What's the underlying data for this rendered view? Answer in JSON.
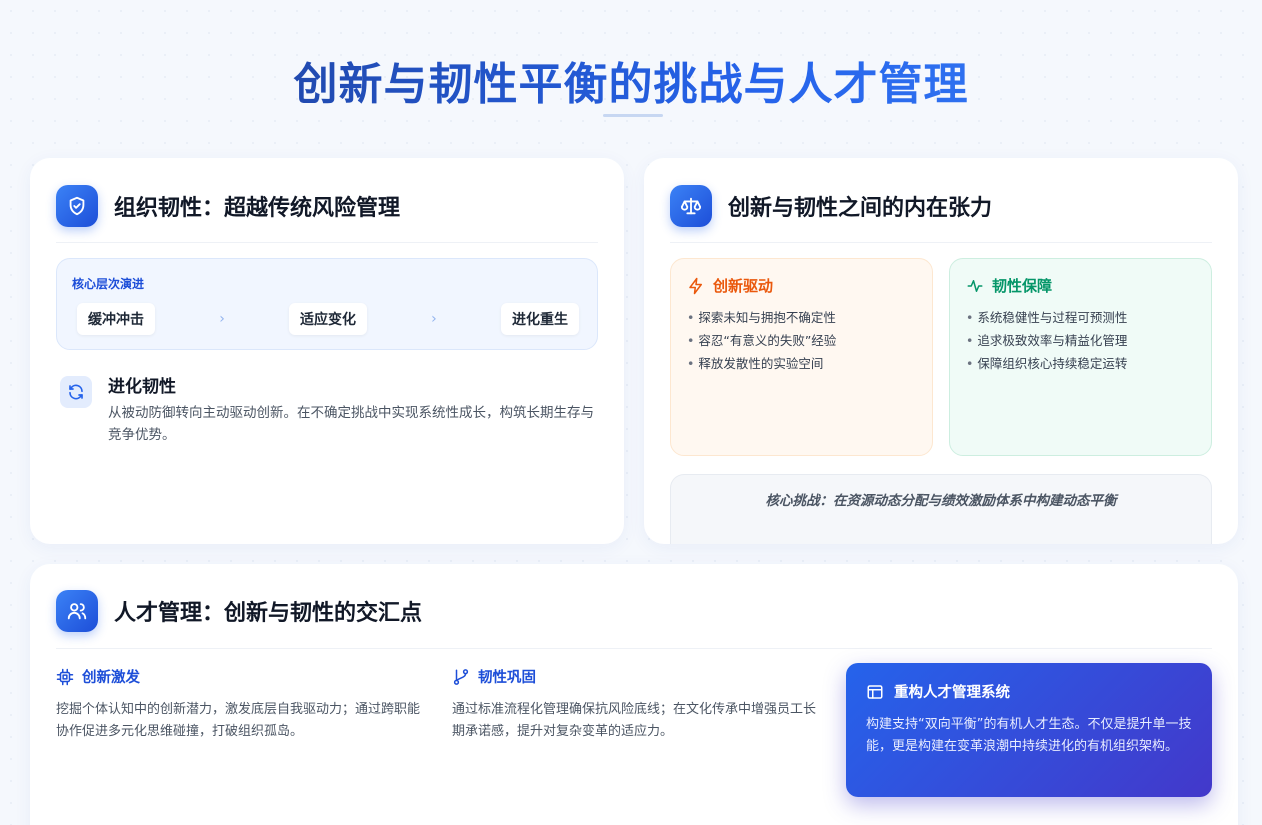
{
  "page": {
    "title": "创新与韧性平衡的挑战与人才管理"
  },
  "resilience_card": {
    "title": "组织韧性：超越传统风险管理",
    "icon": "shield-check-icon",
    "evolution": {
      "label": "核心层次演进",
      "steps": [
        "缓冲冲击",
        "适应变化",
        "进化重生"
      ]
    },
    "feature": {
      "icon": "refresh-icon",
      "title": "进化韧性",
      "desc": "从被动防御转向主动驱动创新。在不确定挑战中实现系统性成长，构筑长期生存与竞争优势。"
    }
  },
  "tension_card": {
    "title": "创新与韧性之间的内在张力",
    "icon": "balance-scale-icon",
    "innovation": {
      "icon": "lightning-icon",
      "title": "创新驱动",
      "color": "#ea580c",
      "items": [
        "探索未知与拥抱不确定性",
        "容忍“有意义的失败”经验",
        "释放发散性的实验空间"
      ]
    },
    "resilience": {
      "icon": "pulse-icon",
      "title": "韧性保障",
      "color": "#059669",
      "items": [
        "系统稳健性与过程可预测性",
        "追求极致效率与精益化管理",
        "保障组织核心持续稳定运转"
      ]
    },
    "challenge": "核心挑战：在资源动态分配与绩效激励体系中构建动态平衡"
  },
  "talent_card": {
    "title": "人才管理：创新与韧性的交汇点",
    "icon": "users-icon",
    "innovation": {
      "icon": "cpu-chip-icon",
      "title": "创新激发",
      "desc": "挖掘个体认知中的创新潜力，激发底层自我驱动力；通过跨职能协作促进多元化思维碰撞，打破组织孤岛。"
    },
    "resilience": {
      "icon": "git-branch-icon",
      "title": "韧性巩固",
      "desc": "通过标准流程化管理确保抗风险底线；在文化传承中增强员工长期承诺感，提升对复杂变革的适应力。"
    },
    "rebuild": {
      "icon": "layout-icon",
      "title": "重构人才管理系统",
      "desc": "构建支持“双向平衡”的有机人才生态。不仅是提升单一技能，更是构建在变革浪潮中持续进化的有机组织架构。"
    }
  },
  "colors": {
    "accent": "#2563eb",
    "accent_dark": "#1d4ed8",
    "orange": "#ea580c",
    "green": "#059669"
  }
}
